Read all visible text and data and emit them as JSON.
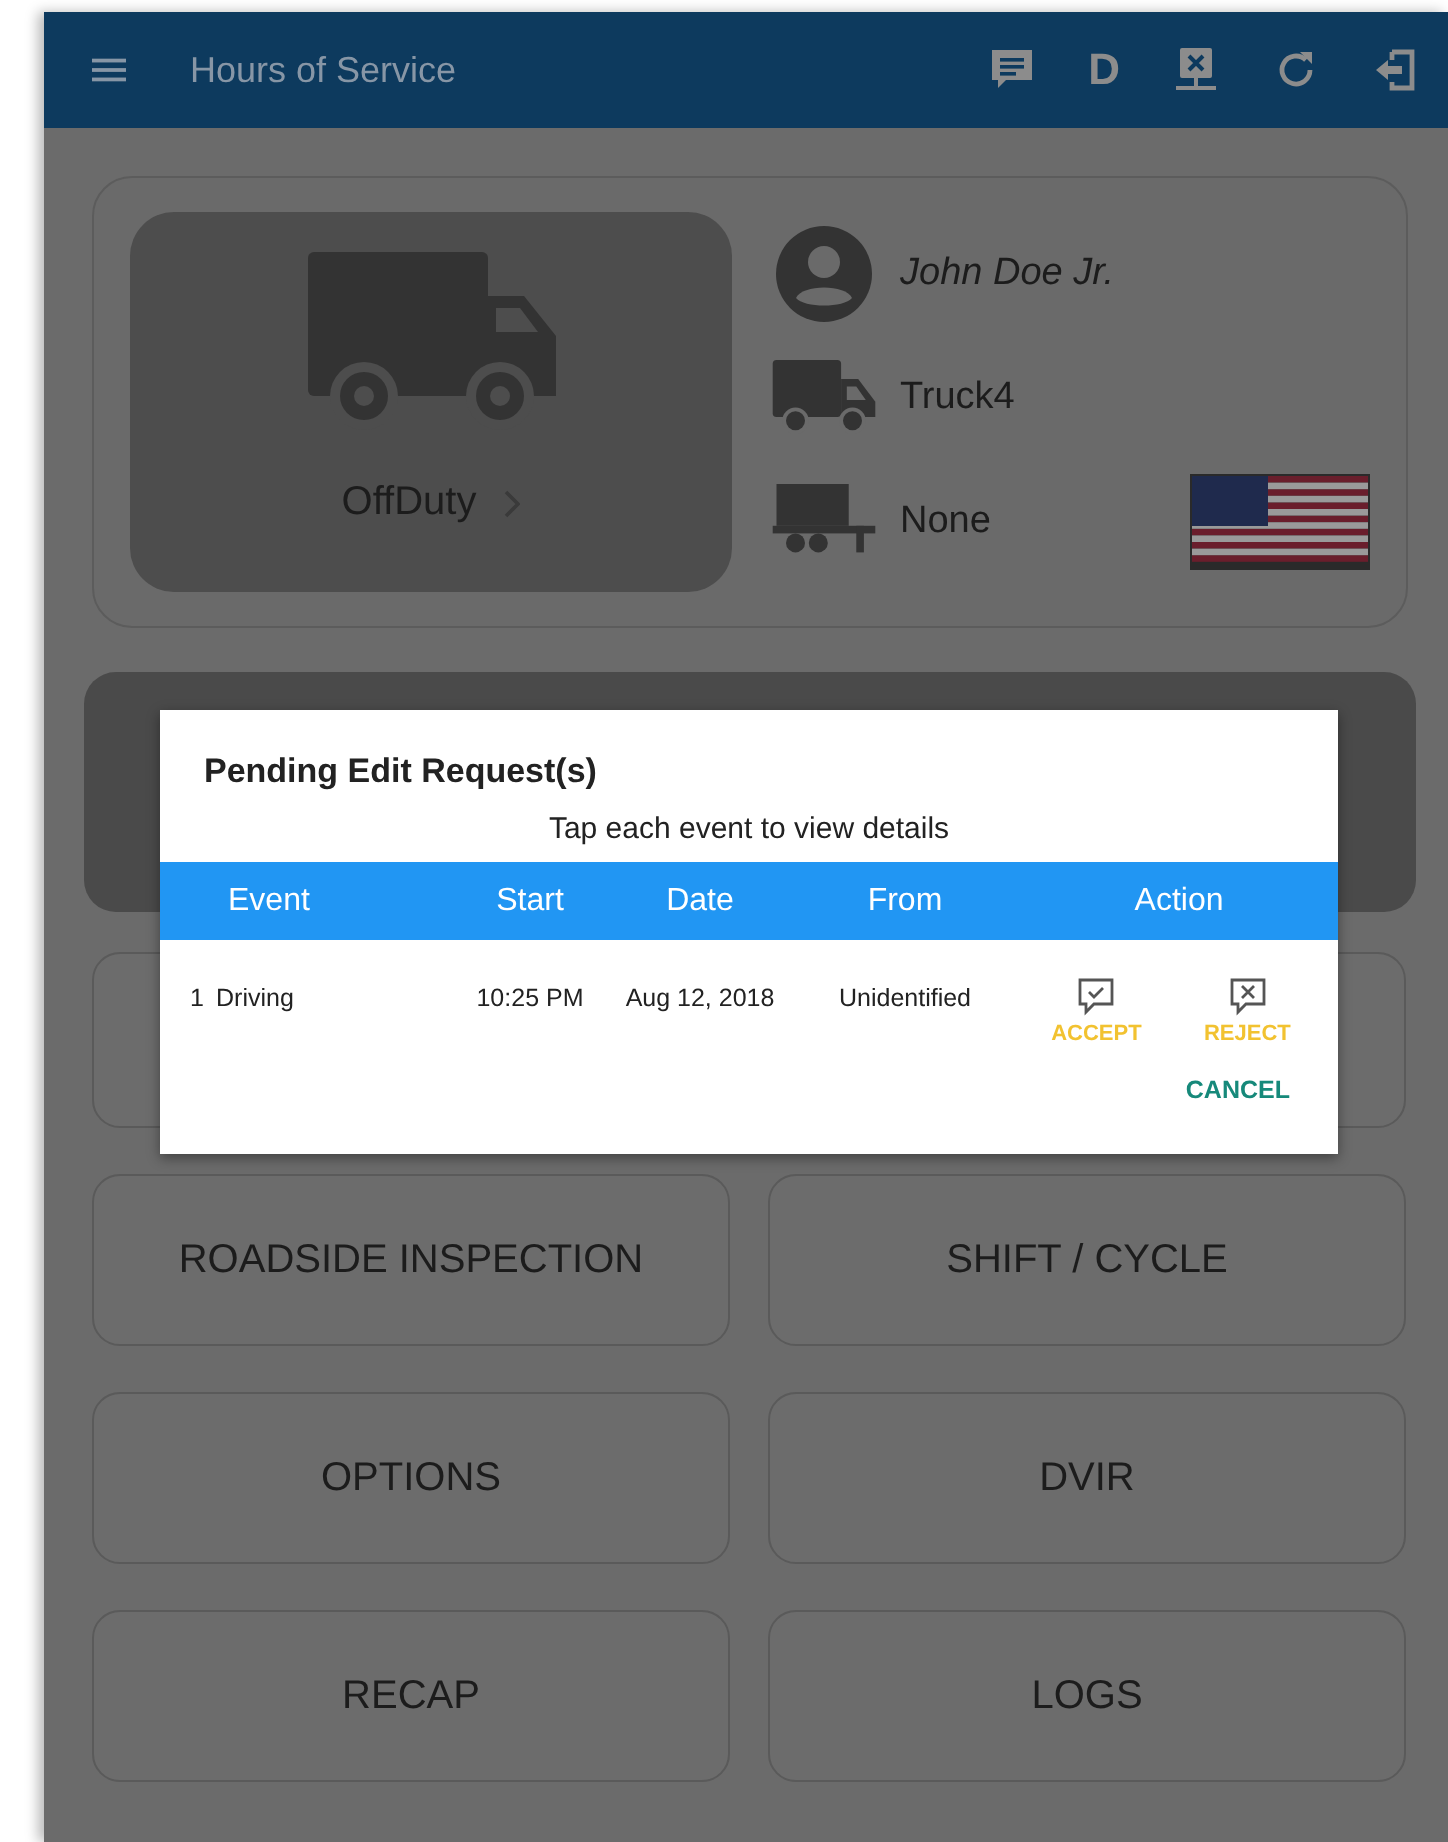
{
  "app_bar": {
    "title": "Hours of Service",
    "status_letter": "D"
  },
  "driver_card": {
    "duty_status": "OffDuty",
    "driver_name": "John Doe Jr.",
    "vehicle": "Truck4",
    "trailer": "None"
  },
  "menu_buttons": [
    {
      "label": "ROADSIDE INSPECTION"
    },
    {
      "label": "SHIFT / CYCLE"
    },
    {
      "label": "OPTIONS"
    },
    {
      "label": "DVIR"
    },
    {
      "label": "RECAP"
    },
    {
      "label": "LOGS"
    }
  ],
  "dialog": {
    "title": "Pending Edit Request(s)",
    "subtitle": "Tap each event to view details",
    "columns": [
      "Event",
      "Start",
      "Date",
      "From",
      "Action"
    ],
    "rows": [
      {
        "number": "1",
        "event": "Driving",
        "start": "10:25 PM",
        "date": "Aug 12, 2018",
        "from": "Unidentified",
        "accept": "ACCEPT",
        "reject": "REJECT"
      }
    ],
    "cancel": "CANCEL"
  }
}
